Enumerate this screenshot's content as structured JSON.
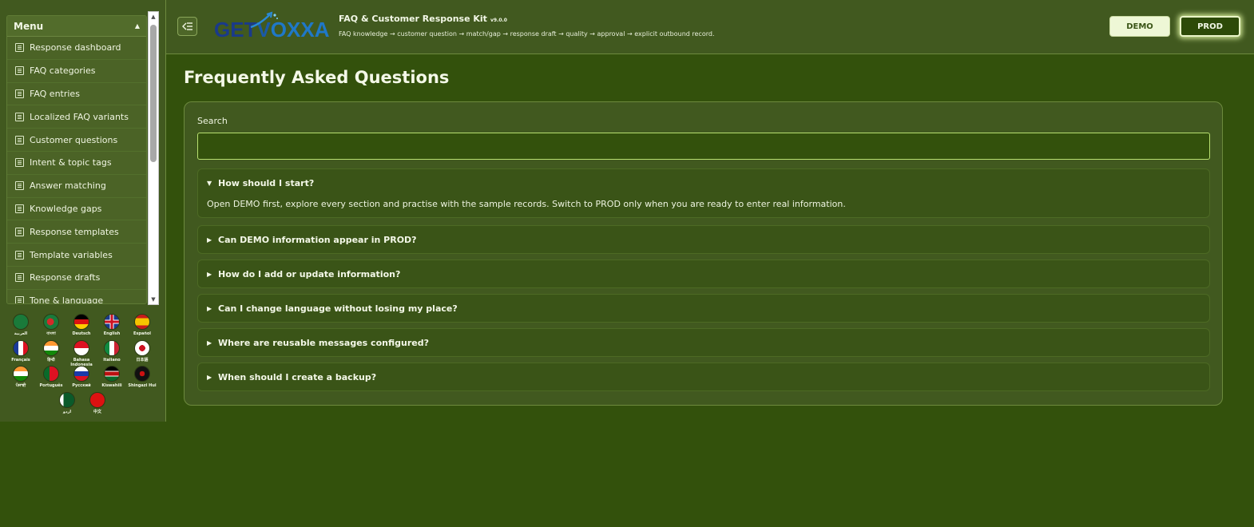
{
  "sidebar": {
    "menu_title": "Menu",
    "items": [
      {
        "label": "Response dashboard",
        "icon": "document-icon"
      },
      {
        "label": "FAQ categories",
        "icon": "document-icon"
      },
      {
        "label": "FAQ entries",
        "icon": "document-icon"
      },
      {
        "label": "Localized FAQ variants",
        "icon": "document-icon"
      },
      {
        "label": "Customer questions",
        "icon": "document-icon"
      },
      {
        "label": "Intent & topic tags",
        "icon": "document-icon"
      },
      {
        "label": "Answer matching",
        "icon": "document-icon"
      },
      {
        "label": "Knowledge gaps",
        "icon": "document-icon"
      },
      {
        "label": "Response templates",
        "icon": "document-icon"
      },
      {
        "label": "Template variables",
        "icon": "document-icon"
      },
      {
        "label": "Response drafts",
        "icon": "document-icon"
      },
      {
        "label": "Tone & language",
        "icon": "document-icon"
      }
    ],
    "languages": [
      {
        "label": "العربية",
        "flag": "saudi-arabia"
      },
      {
        "label": "বাংলা",
        "flag": "bangladesh"
      },
      {
        "label": "Deutsch",
        "flag": "germany"
      },
      {
        "label": "English",
        "flag": "united-kingdom"
      },
      {
        "label": "Español",
        "flag": "spain"
      },
      {
        "label": "Français",
        "flag": "france"
      },
      {
        "label": "हिन्दी",
        "flag": "india"
      },
      {
        "label": "Bahasa Indonesia",
        "flag": "indonesia"
      },
      {
        "label": "Italiano",
        "flag": "italy"
      },
      {
        "label": "日本語",
        "flag": "japan"
      },
      {
        "label": "ਪੰਜਾਬੀ",
        "flag": "india"
      },
      {
        "label": "Português",
        "flag": "portugal"
      },
      {
        "label": "Русский",
        "flag": "russia"
      },
      {
        "label": "Kiswahili",
        "flag": "kenya"
      },
      {
        "label": "Shingazi Hui",
        "flag": "black-red-emblem"
      },
      {
        "label": "اردو",
        "flag": "pakistan"
      },
      {
        "label": "中文",
        "flag": "china"
      }
    ]
  },
  "header": {
    "logo": {
      "get": "GET",
      "v": "V",
      "oxxa": "OXXA"
    },
    "title": "FAQ & Customer Response Kit",
    "version": "v9.0.0",
    "subtitle": "FAQ knowledge → customer question → match/gap → response draft → quality → approval → explicit outbound record.",
    "collapse_icon": "sidebar-collapse-icon",
    "demo_label": "DEMO",
    "prod_label": "PROD"
  },
  "main": {
    "title": "Frequently Asked Questions",
    "search_label": "Search",
    "search_value": "",
    "faqs": [
      {
        "question": "How should I start?",
        "open": true,
        "answer": "Open DEMO first, explore every section and practise with the sample records. Switch to PROD only when you are ready to enter real information."
      },
      {
        "question": "Can DEMO information appear in PROD?",
        "open": false
      },
      {
        "question": "How do I add or update information?",
        "open": false
      },
      {
        "question": "Can I change language without losing my place?",
        "open": false
      },
      {
        "question": "Where are reusable messages configured?",
        "open": false
      },
      {
        "question": "When should I create a backup?",
        "open": false
      }
    ]
  },
  "colors": {
    "background": "#33510c",
    "panel": "#41591f",
    "accent": "#b8e070",
    "text": "#f2f7e6"
  }
}
